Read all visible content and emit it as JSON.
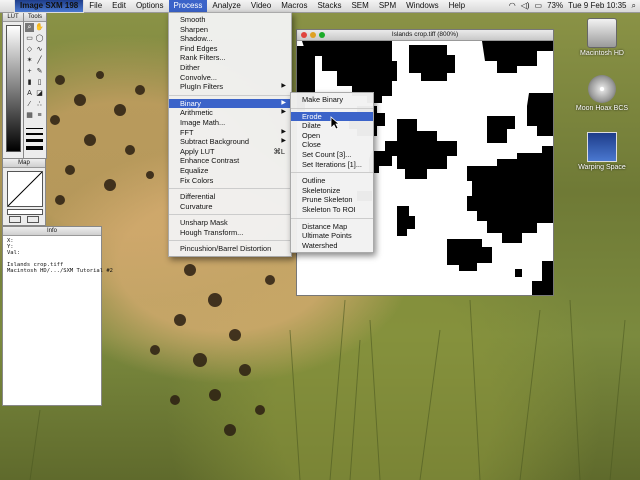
{
  "menubar": {
    "app": "Image SXM 198",
    "items": [
      "File",
      "Edit",
      "Options",
      "Process",
      "Analyze",
      "Video",
      "Macros",
      "Stacks",
      "SEM",
      "SPM",
      "Windows",
      "Help"
    ],
    "active": "Process",
    "battery": "73%",
    "clock": "Tue 9 Feb 10:35"
  },
  "panels": {
    "lut_title": "LUT",
    "tools_title": "Tools",
    "map_title": "Map",
    "info_title": "Info",
    "info_text": "X:\nY:\nVal:\n\nIslands crop.tiff\nMacintosh HD/.../SXM Tutorial #2"
  },
  "image_window": {
    "title": "Islands crop.tiff (800%)"
  },
  "desktop_icons": [
    {
      "label": "Macintosh HD",
      "icon": "hard-drive-icon"
    },
    {
      "label": "Moon Hoax BCS",
      "icon": "disc-icon"
    },
    {
      "label": "Warping Space",
      "icon": "app-icon"
    }
  ],
  "process_menu": {
    "items": [
      {
        "label": "Smooth"
      },
      {
        "label": "Sharpen"
      },
      {
        "label": "Shadow..."
      },
      {
        "label": "Find Edges"
      },
      {
        "label": "Rank Filters..."
      },
      {
        "label": "Dither"
      },
      {
        "label": "Convolve..."
      },
      {
        "label": "PlugIn Filters",
        "submenu": true
      },
      {
        "sep": true
      },
      {
        "label": "Binary",
        "submenu": true,
        "highlighted": true
      },
      {
        "label": "Arithmetic",
        "submenu": true
      },
      {
        "label": "Image Math..."
      },
      {
        "label": "FFT",
        "submenu": true
      },
      {
        "label": "Subtract Background",
        "submenu": true
      },
      {
        "label": "Apply LUT",
        "shortcut": "⌘L"
      },
      {
        "label": "Enhance Contrast"
      },
      {
        "label": "Equalize"
      },
      {
        "label": "Fix Colors"
      },
      {
        "sep": true
      },
      {
        "label": "Differential"
      },
      {
        "label": "Curvature"
      },
      {
        "sep": true
      },
      {
        "label": "Unsharp Mask"
      },
      {
        "label": "Hough Transform..."
      },
      {
        "sep": true
      },
      {
        "label": "Pincushion/Barrel Distortion"
      }
    ]
  },
  "binary_submenu": {
    "items": [
      {
        "label": "Make Binary"
      },
      {
        "sep": true
      },
      {
        "label": "Erode",
        "highlighted": true
      },
      {
        "label": "Dilate"
      },
      {
        "label": "Open"
      },
      {
        "label": "Close"
      },
      {
        "label": "Set Count [3]..."
      },
      {
        "label": "Set Iterations [1]..."
      },
      {
        "sep": true
      },
      {
        "label": "Outline"
      },
      {
        "label": "Skeletonize"
      },
      {
        "label": "Prune Skeleton"
      },
      {
        "label": "Skeleton To ROI"
      },
      {
        "sep": true
      },
      {
        "label": "Distance Map"
      },
      {
        "label": "Ultimate Points"
      },
      {
        "label": "Watershed"
      }
    ]
  },
  "colors": {
    "highlight": "#3b63c9",
    "menu_bg": "#f2f2f2"
  }
}
